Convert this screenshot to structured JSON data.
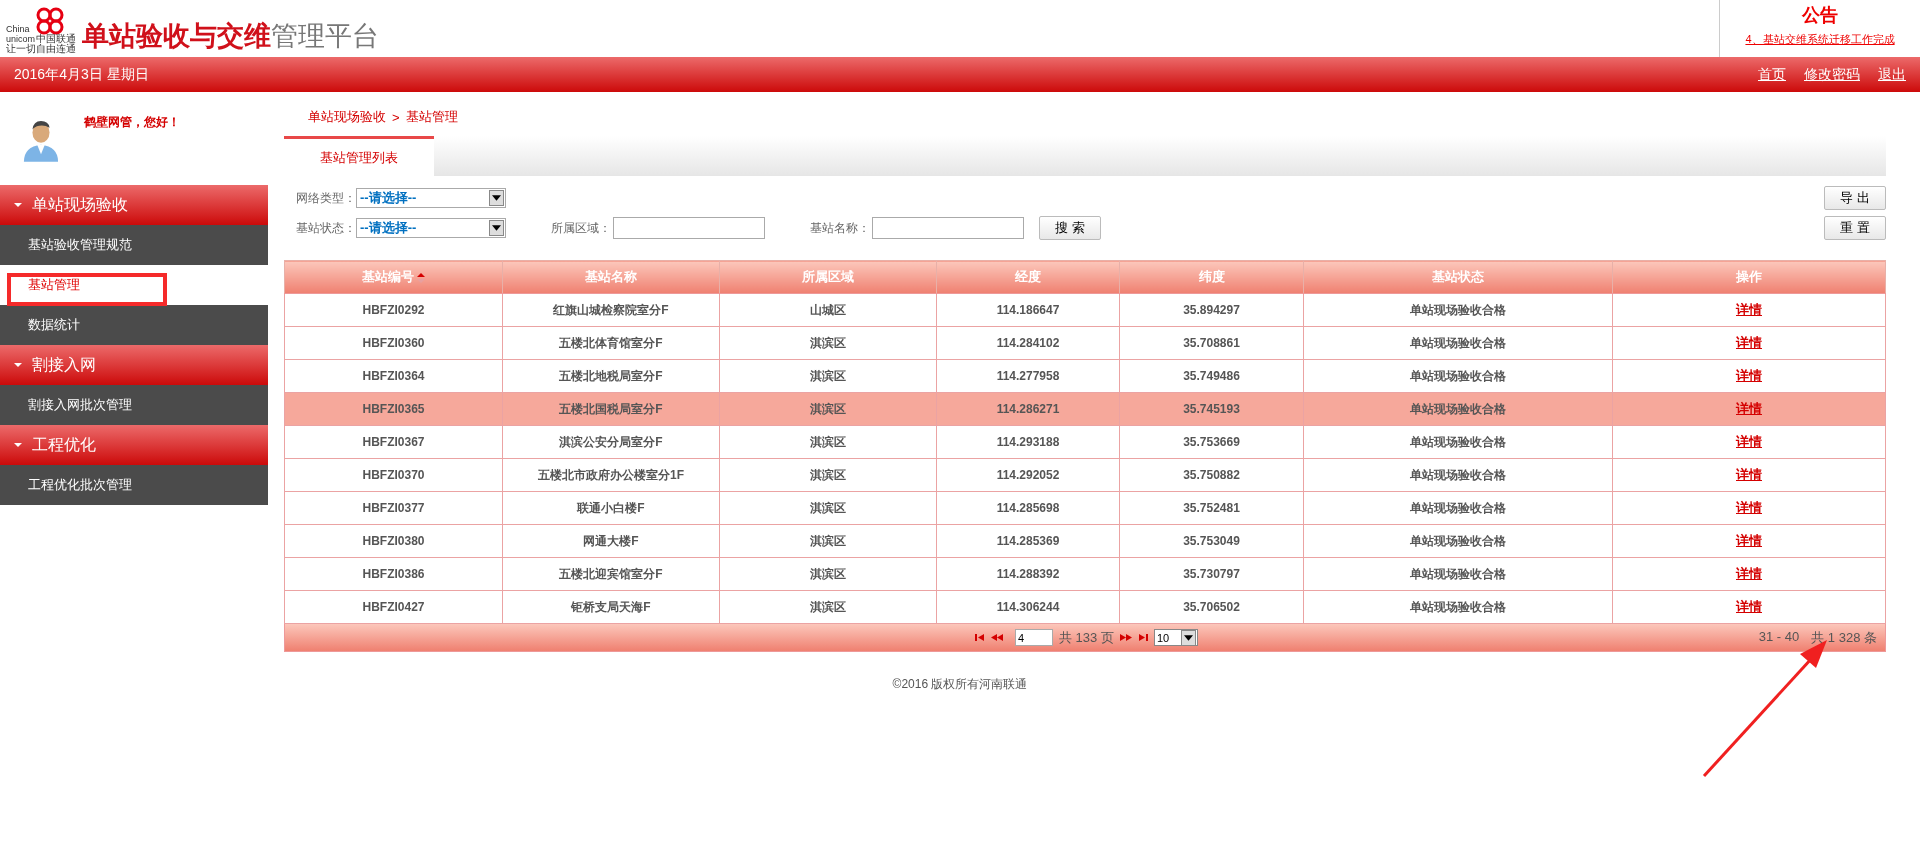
{
  "header": {
    "logo": {
      "brand_en_1": "China",
      "brand_en_2": "unicom",
      "brand_cn": "中国联通",
      "slogan": "让一切自由连通"
    },
    "title_main": "单站验收与交维",
    "title_rest": "管理平台"
  },
  "notice": {
    "title": "公告",
    "link": "4、基站交维系统迁移工作完成"
  },
  "topbar": {
    "date": "2016年4月3日 星期日",
    "links": [
      "首页",
      "修改密码",
      "退出"
    ]
  },
  "user": {
    "greeting": "鹤壁网管，您好！"
  },
  "sidebar": {
    "groups": [
      {
        "label": "单站现场验收",
        "expanded": true,
        "items": [
          {
            "label": "基站验收管理规范",
            "selected": false
          },
          {
            "label": "基站管理",
            "selected": true
          },
          {
            "label": "数据统计",
            "selected": false
          }
        ]
      },
      {
        "label": "割接入网",
        "expanded": true,
        "items": [
          {
            "label": "割接入网批次管理",
            "selected": false
          }
        ]
      },
      {
        "label": "工程优化",
        "expanded": true,
        "items": [
          {
            "label": "工程优化批次管理",
            "selected": false
          }
        ]
      }
    ]
  },
  "breadcrumb": {
    "items": [
      "单站现场验收",
      "基站管理"
    ],
    "separator": ">"
  },
  "tabs": [
    {
      "label": "基站管理列表",
      "selected": true
    }
  ],
  "filters": {
    "rows": [
      [
        {
          "kind": "select",
          "label": "网络类型：",
          "value": "--请选择--"
        }
      ],
      [
        {
          "kind": "select",
          "label": "基站状态：",
          "value": "--请选择--"
        },
        {
          "kind": "input",
          "label": "所属区域："
        },
        {
          "kind": "input",
          "label": "基站名称："
        },
        {
          "kind": "button",
          "label": "搜 索"
        }
      ]
    ],
    "side_buttons": [
      "导 出",
      "重 置"
    ]
  },
  "table": {
    "columns": [
      {
        "label": "基站编号",
        "sorted": true
      },
      {
        "label": "基站名称",
        "sorted": false
      },
      {
        "label": "所属区域",
        "sorted": false
      },
      {
        "label": "经度",
        "sorted": false
      },
      {
        "label": "纬度",
        "sorted": false
      },
      {
        "label": "基站状态",
        "sorted": false
      },
      {
        "label": "操作",
        "sorted": false
      }
    ],
    "rows": [
      {
        "cells": [
          "HBFZI0292",
          "红旗山城检察院室分F",
          "山城区",
          "114.186647",
          "35.894297",
          "单站现场验收合格"
        ],
        "action": "详情",
        "selected": false
      },
      {
        "cells": [
          "HBFZI0360",
          "五楼北体育馆室分F",
          "淇滨区",
          "114.284102",
          "35.708861",
          "单站现场验收合格"
        ],
        "action": "详情",
        "selected": false
      },
      {
        "cells": [
          "HBFZI0364",
          "五楼北地税局室分F",
          "淇滨区",
          "114.277958",
          "35.749486",
          "单站现场验收合格"
        ],
        "action": "详情",
        "selected": false
      },
      {
        "cells": [
          "HBFZI0365",
          "五楼北国税局室分F",
          "淇滨区",
          "114.286271",
          "35.745193",
          "单站现场验收合格"
        ],
        "action": "详情",
        "selected": true
      },
      {
        "cells": [
          "HBFZI0367",
          "淇滨公安分局室分F",
          "淇滨区",
          "114.293188",
          "35.753669",
          "单站现场验收合格"
        ],
        "action": "详情",
        "selected": false
      },
      {
        "cells": [
          "HBFZI0370",
          "五楼北市政府办公楼室分1F",
          "淇滨区",
          "114.292052",
          "35.750882",
          "单站现场验收合格"
        ],
        "action": "详情",
        "selected": false
      },
      {
        "cells": [
          "HBFZI0377",
          "联通小白楼F",
          "淇滨区",
          "114.285698",
          "35.752481",
          "单站现场验收合格"
        ],
        "action": "详情",
        "selected": false
      },
      {
        "cells": [
          "HBFZI0380",
          "网通大楼F",
          "淇滨区",
          "114.285369",
          "35.753049",
          "单站现场验收合格"
        ],
        "action": "详情",
        "selected": false
      },
      {
        "cells": [
          "HBFZI0386",
          "五楼北迎宾馆室分F",
          "淇滨区",
          "114.288392",
          "35.730797",
          "单站现场验收合格"
        ],
        "action": "详情",
        "selected": false
      },
      {
        "cells": [
          "HBFZI0427",
          "钜桥支局天海F",
          "淇滨区",
          "114.306244",
          "35.706502",
          "单站现场验收合格"
        ],
        "action": "详情",
        "selected": false
      }
    ]
  },
  "pager": {
    "page": "4",
    "page_total": "共 133 页",
    "page_size": "10",
    "range": "31 - 40",
    "total": "共 1 328 条"
  },
  "footer": "©2016  版权所有河南联通"
}
